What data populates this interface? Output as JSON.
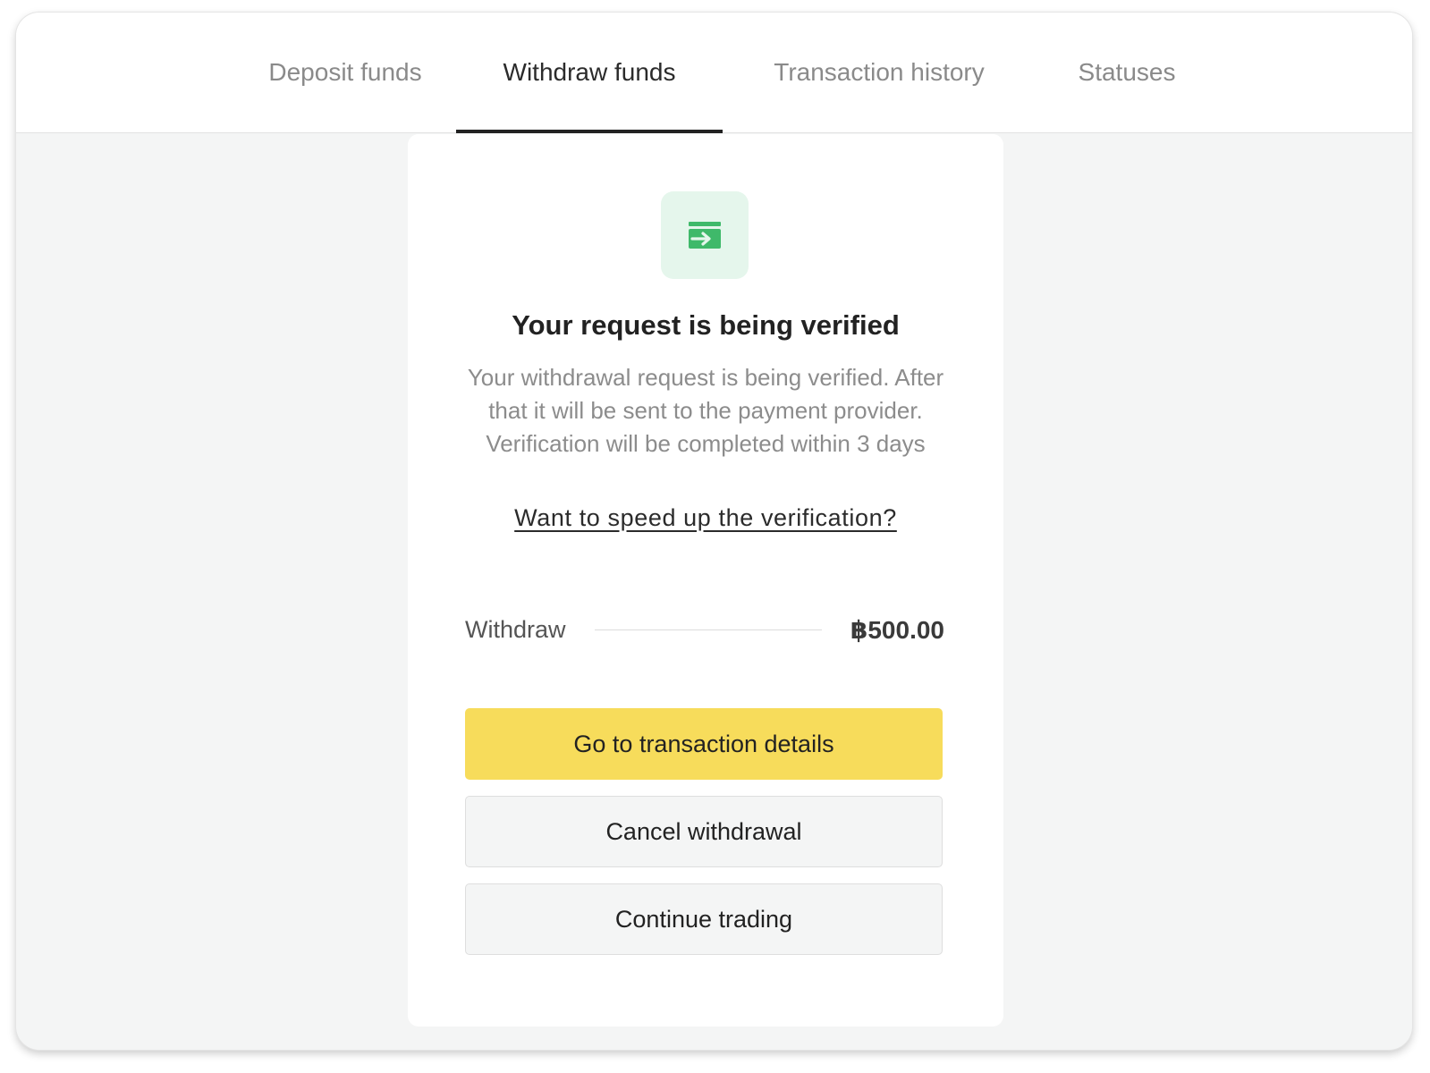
{
  "tabs": [
    {
      "label": "Deposit funds",
      "active": false
    },
    {
      "label": "Withdraw funds",
      "active": true
    },
    {
      "label": "Transaction history",
      "active": false
    },
    {
      "label": "Statuses",
      "active": false
    }
  ],
  "status_card": {
    "icon": "card-arrow-icon",
    "icon_color": "#3fb96a",
    "icon_bg": "#e5f6ec",
    "title": "Your request is being verified",
    "description": "Your withdrawal request is being verified. After that it will be sent to the payment provider. Verification will be completed within 3 days",
    "speed_up_link": "Want to speed up the verification?"
  },
  "withdraw_summary": {
    "label": "Withdraw",
    "amount": "฿500.00"
  },
  "actions": {
    "details_label": "Go to transaction details",
    "details_color": "#f7dc5b",
    "cancel_label": "Cancel withdrawal",
    "continue_label": "Continue trading"
  }
}
